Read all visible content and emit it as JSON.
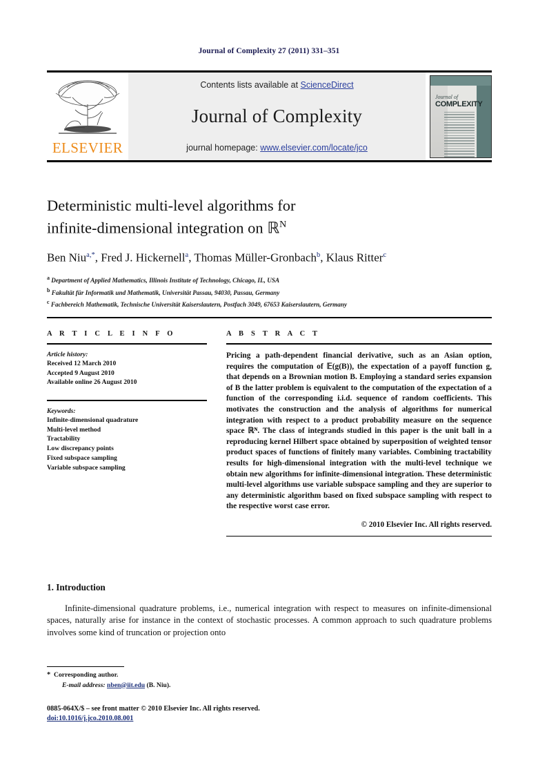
{
  "running_head": "Journal of Complexity 27 (2011) 331–351",
  "masthead": {
    "contents_prefix": "Contents lists available at ",
    "contents_link": "ScienceDirect",
    "journal_title": "Journal of Complexity",
    "homepage_prefix": "journal homepage: ",
    "homepage_link": "www.elsevier.com/locate/jco",
    "publisher": "ELSEVIER",
    "cover": {
      "line1": "Journal of",
      "line2": "COMPLEXITY"
    }
  },
  "article": {
    "title_line1": "Deterministic multi-level algorithms for",
    "title_line2": "infinite-dimensional integration on",
    "title_space": "ℝ",
    "title_sup": "N",
    "authors": [
      {
        "name": "Ben Niu",
        "sup": "a,*"
      },
      {
        "name": "Fred J. Hickernell",
        "sup": "a"
      },
      {
        "name": "Thomas Müller-Gronbach",
        "sup": "b"
      },
      {
        "name": "Klaus Ritter",
        "sup": "c"
      }
    ],
    "affiliations": [
      {
        "mark": "a",
        "text": "Department of Applied Mathematics, Illinois Institute of Technology, Chicago, IL, USA"
      },
      {
        "mark": "b",
        "text": "Fakultät für Informatik und Mathematik, Universität Passau, 94030, Passau, Germany"
      },
      {
        "mark": "c",
        "text": "Fachbereich Mathematik, Technische Universität Kaiserslautern, Postfach 3049, 67653 Kaiserslautern, Germany"
      }
    ]
  },
  "article_info": {
    "heading": "A R T I C L E   I N F O",
    "history_label": "Article history:",
    "history": [
      "Received 12 March 2010",
      "Accepted 9 August 2010",
      "Available online 26 August 2010"
    ],
    "keywords_label": "Keywords:",
    "keywords": [
      "Infinite-dimensional quadrature",
      "Multi-level method",
      "Tractability",
      "Low discrepancy points",
      "Fixed subspace sampling",
      "Variable subspace sampling"
    ]
  },
  "abstract": {
    "heading": "A B S T R A C T",
    "text": "Pricing a path-dependent financial derivative, such as an Asian option, requires the computation of 𝔼(g(B)), the expectation of a payoff function g, that depends on a Brownian motion B. Employing a standard series expansion of B the latter problem is equivalent to the computation of the expectation of a function of the corresponding i.i.d. sequence of random coefficients. This motivates the construction and the analysis of algorithms for numerical integration with respect to a product probability measure on the sequence space ℝᴺ. The class of integrands studied in this paper is the unit ball in a reproducing kernel Hilbert space obtained by superposition of weighted tensor product spaces of functions of finitely many variables. Combining tractability results for high-dimensional integration with the multi-level technique we obtain new algorithms for infinite-dimensional integration. These deterministic multi-level algorithms use variable subspace sampling and they are superior to any deterministic algorithm based on fixed subspace sampling with respect to the respective worst case error.",
    "copyright": "© 2010 Elsevier Inc. All rights reserved."
  },
  "introduction": {
    "heading": "1. Introduction",
    "paragraph": "Infinite-dimensional quadrature problems, i.e., numerical integration with respect to measures on infinite-dimensional spaces, naturally arise for instance in the context of stochastic processes. A common approach to such quadrature problems involves some kind of truncation or projection onto"
  },
  "footnotes": {
    "corresponding": "Corresponding author.",
    "email_label": "E-mail address:",
    "email": "nben@iit.edu",
    "email_suffix": "(B. Niu)."
  },
  "footer": {
    "issn_line": "0885-064X/$ – see front matter © 2010 Elsevier Inc. All rights reserved.",
    "doi": "doi:10.1016/j.jco.2010.08.001"
  },
  "colors": {
    "link": "#2b3f9e",
    "elsevier_orange": "#ED8B19",
    "running_head": "#1b1b52",
    "cover_teal": "#5d7b79"
  }
}
